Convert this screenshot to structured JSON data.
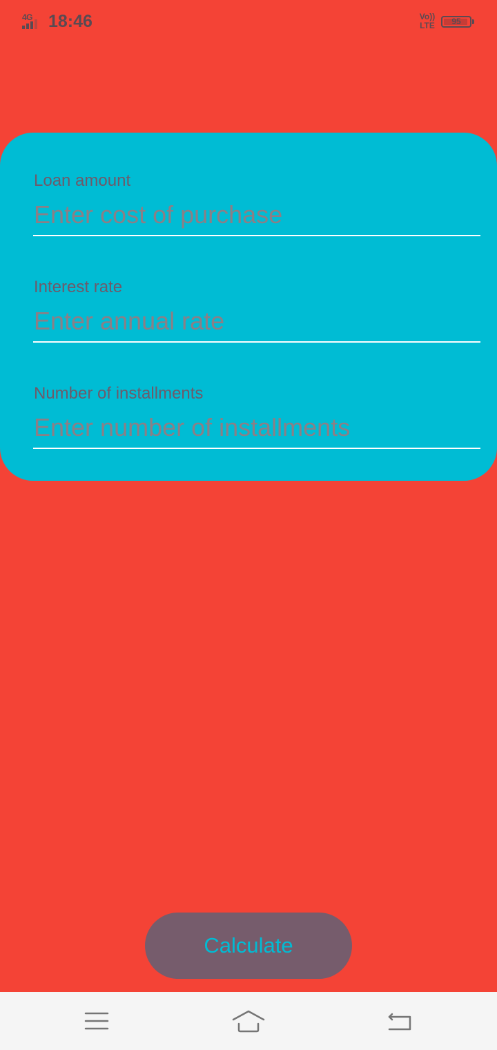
{
  "status_bar": {
    "network": "4G",
    "time": "18:46",
    "volte_top": "Vo))",
    "volte_bottom": "LTE",
    "battery": "95",
    "battery_level": 0.95
  },
  "form": {
    "loan": {
      "label": "Loan amount",
      "placeholder": "Enter cost of purchase",
      "value": ""
    },
    "interest": {
      "label": "Interest rate",
      "placeholder": "Enter annual rate",
      "value": ""
    },
    "installments": {
      "label": "Number of installments",
      "placeholder": "Enter number of installments",
      "value": ""
    }
  },
  "calculate_label": "Calculate",
  "nav": {
    "menu_icon": "menu-icon",
    "home_icon": "home-icon",
    "back_icon": "back-icon"
  },
  "colors": {
    "background": "#f44336",
    "card": "#00bcd4",
    "button": "#765c6c",
    "button_text": "#00bcd4",
    "nav_bar": "#f5f5f5"
  }
}
